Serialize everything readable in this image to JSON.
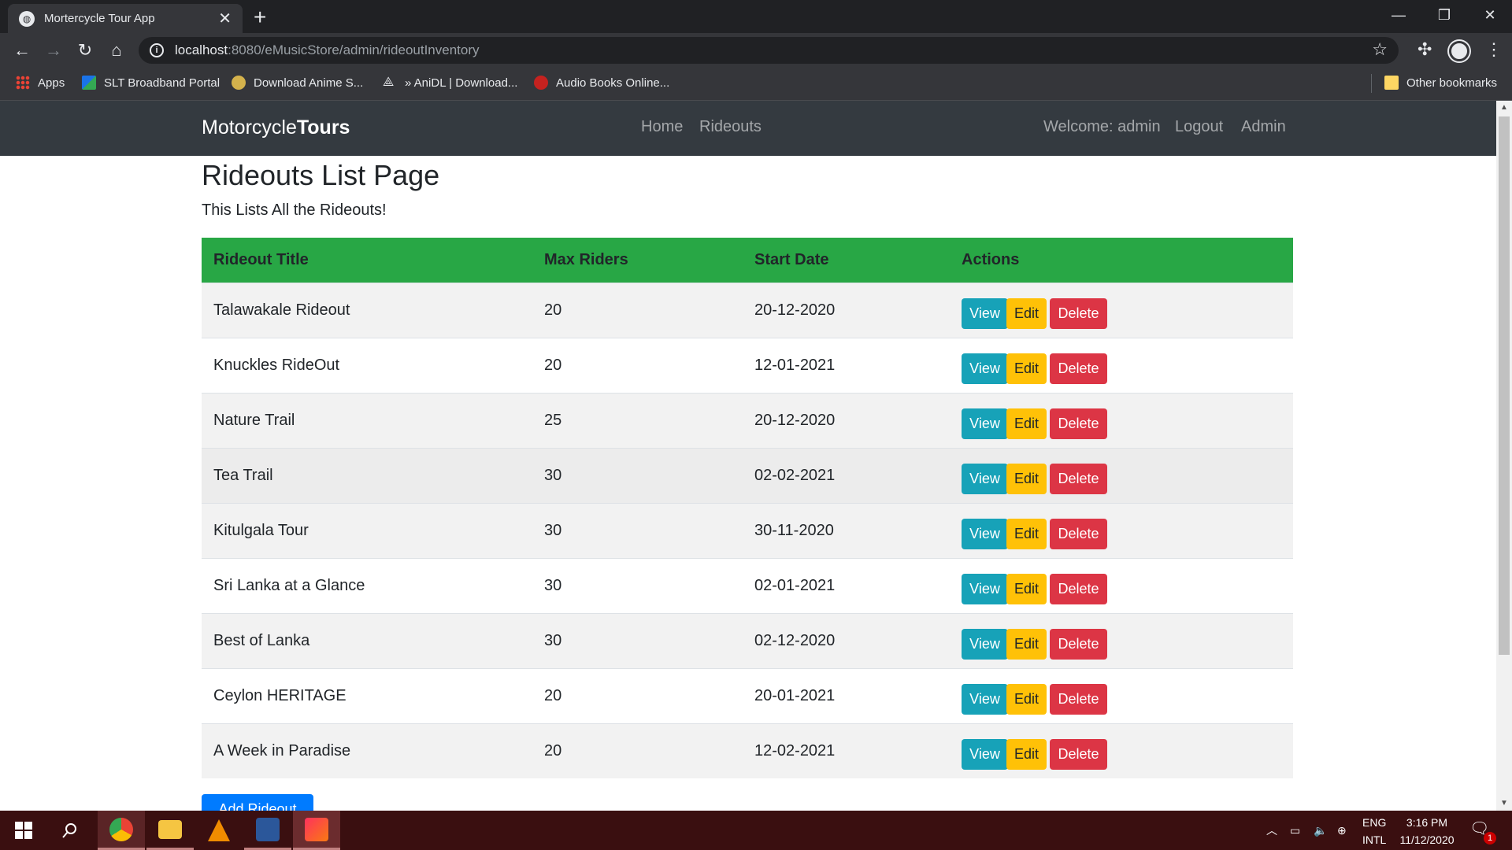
{
  "browser": {
    "tab_title": "Mortercycle Tour App",
    "tab_close": "✕",
    "new_tab": "+",
    "url_host": "localhost",
    "url_rest": ":8080/eMusicStore/admin/rideoutInventory",
    "window_controls": {
      "minimize": "—",
      "restore": "❐",
      "close": "✕"
    },
    "bookmarks": [
      {
        "label": "Apps",
        "icon": "apps-grid-icon"
      },
      {
        "label": "SLT Broadband Portal",
        "icon": "slt-icon"
      },
      {
        "label": "Download Anime S...",
        "icon": "anime-icon"
      },
      {
        "label": "» AniDL | Download...",
        "icon": "anidl-icon"
      },
      {
        "label": "Audio Books Online...",
        "icon": "audiobooks-icon"
      }
    ],
    "other_bookmarks": "Other bookmarks"
  },
  "navbar": {
    "brand_light": "Motorcycle",
    "brand_bold": "Tours",
    "links": [
      "Home",
      "Rideouts"
    ],
    "welcome": "Welcome: admin",
    "logout": "Logout",
    "admin": "Admin"
  },
  "page": {
    "title": "Rideouts List Page",
    "lead": "This Lists All the Rideouts!"
  },
  "table": {
    "headers": [
      "Rideout Title",
      "Max Riders",
      "Start Date",
      "Actions"
    ],
    "rows": [
      {
        "title": "Talawakale Rideout",
        "max_riders": "20",
        "start_date": "20-12-2020"
      },
      {
        "title": "Knuckles RideOut",
        "max_riders": "20",
        "start_date": "12-01-2021"
      },
      {
        "title": "Nature Trail",
        "max_riders": "25",
        "start_date": "20-12-2020"
      },
      {
        "title": "Tea Trail",
        "max_riders": "30",
        "start_date": "02-02-2021"
      },
      {
        "title": "Kitulgala Tour",
        "max_riders": "30",
        "start_date": "30-11-2020"
      },
      {
        "title": "Sri Lanka at a Glance",
        "max_riders": "30",
        "start_date": "02-01-2021"
      },
      {
        "title": "Best of Lanka",
        "max_riders": "30",
        "start_date": "02-12-2020"
      },
      {
        "title": "Ceylon HERITAGE",
        "max_riders": "20",
        "start_date": "20-01-2021"
      },
      {
        "title": "A Week in Paradise",
        "max_riders": "20",
        "start_date": "12-02-2021"
      }
    ],
    "actions": {
      "view": "View",
      "edit": "Edit",
      "delete": "Delete"
    }
  },
  "add_button": "Add Rideout",
  "taskbar": {
    "lang_top": "ENG",
    "lang_bottom": "INTL",
    "time": "3:16 PM",
    "date": "11/12/2020",
    "notification_count": "1"
  },
  "colors": {
    "navbar": "#343a40",
    "table_header": "#28a745",
    "view": "#17a2b8",
    "edit": "#ffc107",
    "delete": "#dc3545",
    "primary": "#007bff",
    "taskbar": "#3a0f10"
  }
}
